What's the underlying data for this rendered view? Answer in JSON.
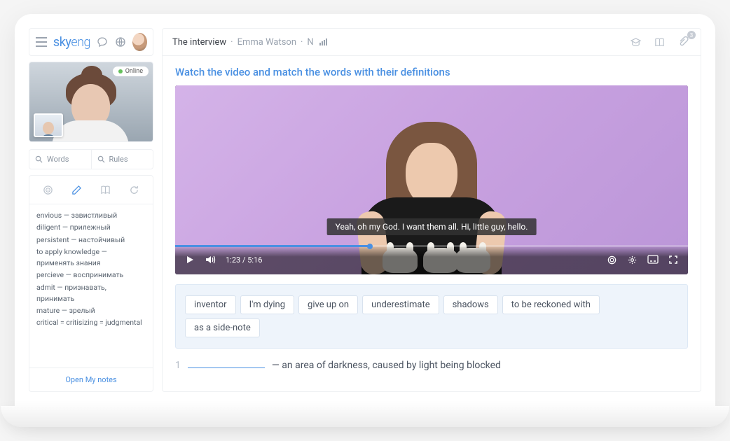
{
  "brand": {
    "part1": "sky",
    "part2": "eng"
  },
  "call": {
    "status": "Online"
  },
  "search": {
    "words_placeholder": "Words",
    "rules_placeholder": "Rules"
  },
  "vocab": [
    "envious — завистливый",
    "diligent — прилежный",
    "persistent — настойчивый",
    "to apply knowledge — применять знания",
    "percieve — воспринимать",
    "admit — признавать, принимать",
    "mature — зрелый",
    "critical = critisizing = judgmental"
  ],
  "open_notes": "Open My notes",
  "header": {
    "title": "The interview",
    "subtitle": "Emma Watson",
    "level": "N",
    "attachment_count": "3"
  },
  "instruction": "Watch the video and match the words with their definitions",
  "video": {
    "caption": "Yeah, oh my God. I want them all. Hi, little guy, hello.",
    "time": "1:23 / 5:16"
  },
  "chips": [
    "inventor",
    "I'm dying",
    "give up on",
    "underestimate",
    "shadows",
    "to be reckoned with",
    "as a side-note"
  ],
  "question": {
    "num": "1",
    "def": "— an area of darkness, caused by light being blocked"
  }
}
